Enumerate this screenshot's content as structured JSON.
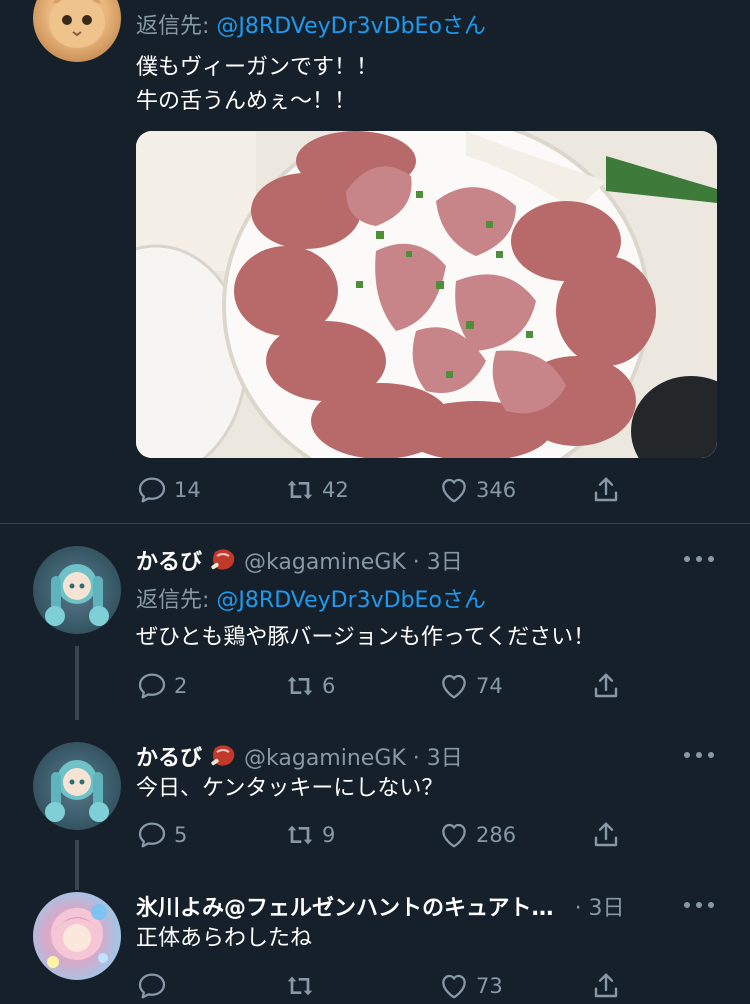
{
  "tweets": [
    {
      "reply_label": "返信先:",
      "mention": "@J8RDVeyDr3vDbEo",
      "mention_suffix": "さん",
      "text": "僕もヴィーガンです！！\n牛の舌うんめぇ〜！！",
      "actions": {
        "replies": "14",
        "retweets": "42",
        "likes": "346"
      }
    },
    {
      "name": "かるび",
      "handle": "@kagamineGK",
      "time": "· 3日",
      "reply_label": "返信先:",
      "mention": "@J8RDVeyDr3vDbEo",
      "mention_suffix": "さん",
      "text": "ぜひとも鶏や豚バージョンも作ってください！",
      "actions": {
        "replies": "2",
        "retweets": "6",
        "likes": "74"
      }
    },
    {
      "name": "かるび",
      "handle": "@kagamineGK",
      "time": "· 3日",
      "text": "今日、ケンタッキーにしない？",
      "actions": {
        "replies": "5",
        "retweets": "9",
        "likes": "286"
      }
    },
    {
      "name": "氷川よみ@フェルゼンハントのキュアト…",
      "time": "· 3日",
      "text": "正体あらわしたね",
      "actions": {
        "replies": "",
        "retweets": "",
        "likes": "73"
      }
    }
  ],
  "colors": {
    "background": "#15202b",
    "muted": "#8899a6",
    "accent": "#1d9bf0",
    "divider": "#38444d"
  },
  "icons": [
    "reply-icon",
    "retweet-icon",
    "like-icon",
    "share-icon",
    "more-icon",
    "meat-emoji-icon"
  ]
}
